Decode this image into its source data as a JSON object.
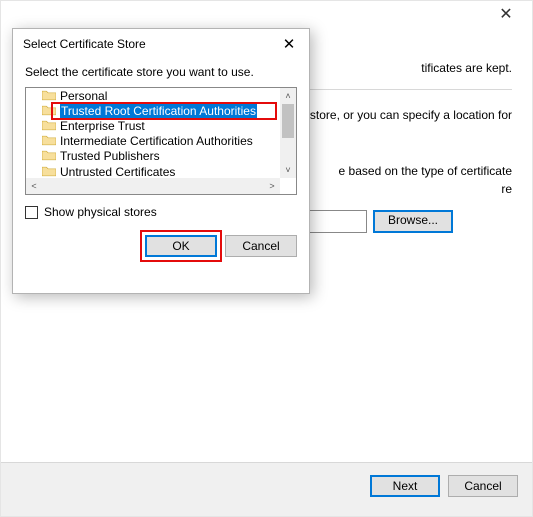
{
  "wizard": {
    "close_glyph": "✕",
    "frag_kept": "tificates are kept.",
    "frag_spec": "e store, or you can specify a location for",
    "frag_auto1": "e based on the type of certificate",
    "frag_auto2": "re",
    "store_value": "",
    "browse_label": "Browse...",
    "next_label": "Next",
    "cancel_label": "Cancel"
  },
  "modal": {
    "title": "Select Certificate Store",
    "close_glyph": "✕",
    "instruction": "Select the certificate store you want to use.",
    "items": [
      {
        "label": "Personal",
        "selected": false
      },
      {
        "label": "Trusted Root Certification Authorities",
        "selected": true
      },
      {
        "label": "Enterprise Trust",
        "selected": false
      },
      {
        "label": "Intermediate Certification Authorities",
        "selected": false
      },
      {
        "label": "Trusted Publishers",
        "selected": false
      },
      {
        "label": "Untrusted Certificates",
        "selected": false
      }
    ],
    "show_physical_label": "Show physical stores",
    "show_physical_checked": false,
    "ok_label": "OK",
    "cancel_label": "Cancel",
    "scroll": {
      "up": "˄",
      "down": "˅",
      "left": "˂",
      "right": "˃"
    }
  }
}
